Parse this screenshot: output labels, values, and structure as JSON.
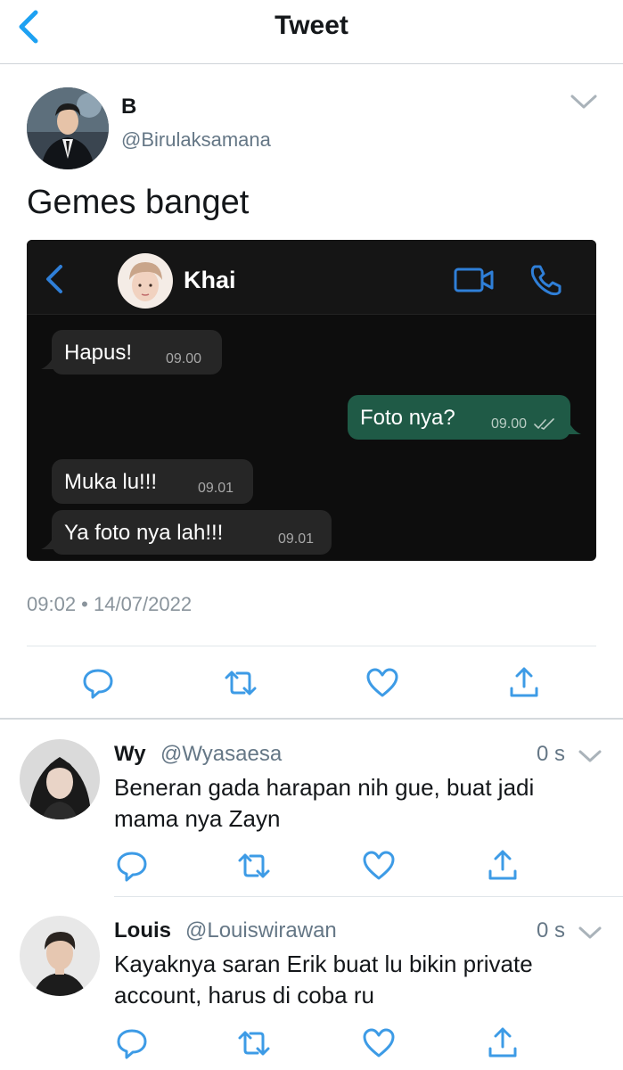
{
  "header": {
    "title": "Tweet"
  },
  "tweet": {
    "author_name": "B",
    "author_handle": "@Birulaksamana",
    "text": "Gemes banget",
    "timestamp": "09:02 • 14/07/2022"
  },
  "chat": {
    "contact_name": "Khai",
    "messages": [
      {
        "text": "Hapus!",
        "time": "09.00",
        "direction": "in"
      },
      {
        "text": "Foto nya?",
        "time": "09.00",
        "direction": "out"
      },
      {
        "text": "Muka lu!!!",
        "time": "09.01",
        "direction": "in"
      },
      {
        "text": "Ya foto nya lah!!!",
        "time": "09.01",
        "direction": "in"
      }
    ]
  },
  "actions": [
    "reply-icon",
    "retweet-icon",
    "like-icon",
    "share-icon"
  ],
  "replies": [
    {
      "name": "Wy",
      "handle": "@Wyasaesa",
      "time": "0 s",
      "text": "Beneran gada harapan nih gue, buat jadi mama nya Zayn"
    },
    {
      "name": "Louis",
      "handle": "@Louiswirawan",
      "time": "0 s",
      "text": "Kayaknya saran Erik buat lu bikin private account, harus di coba ru"
    }
  ],
  "colors": {
    "accent": "#1da1f2",
    "chat_out": "#1f5a46",
    "chat_in": "#262626",
    "muted": "#657786"
  }
}
